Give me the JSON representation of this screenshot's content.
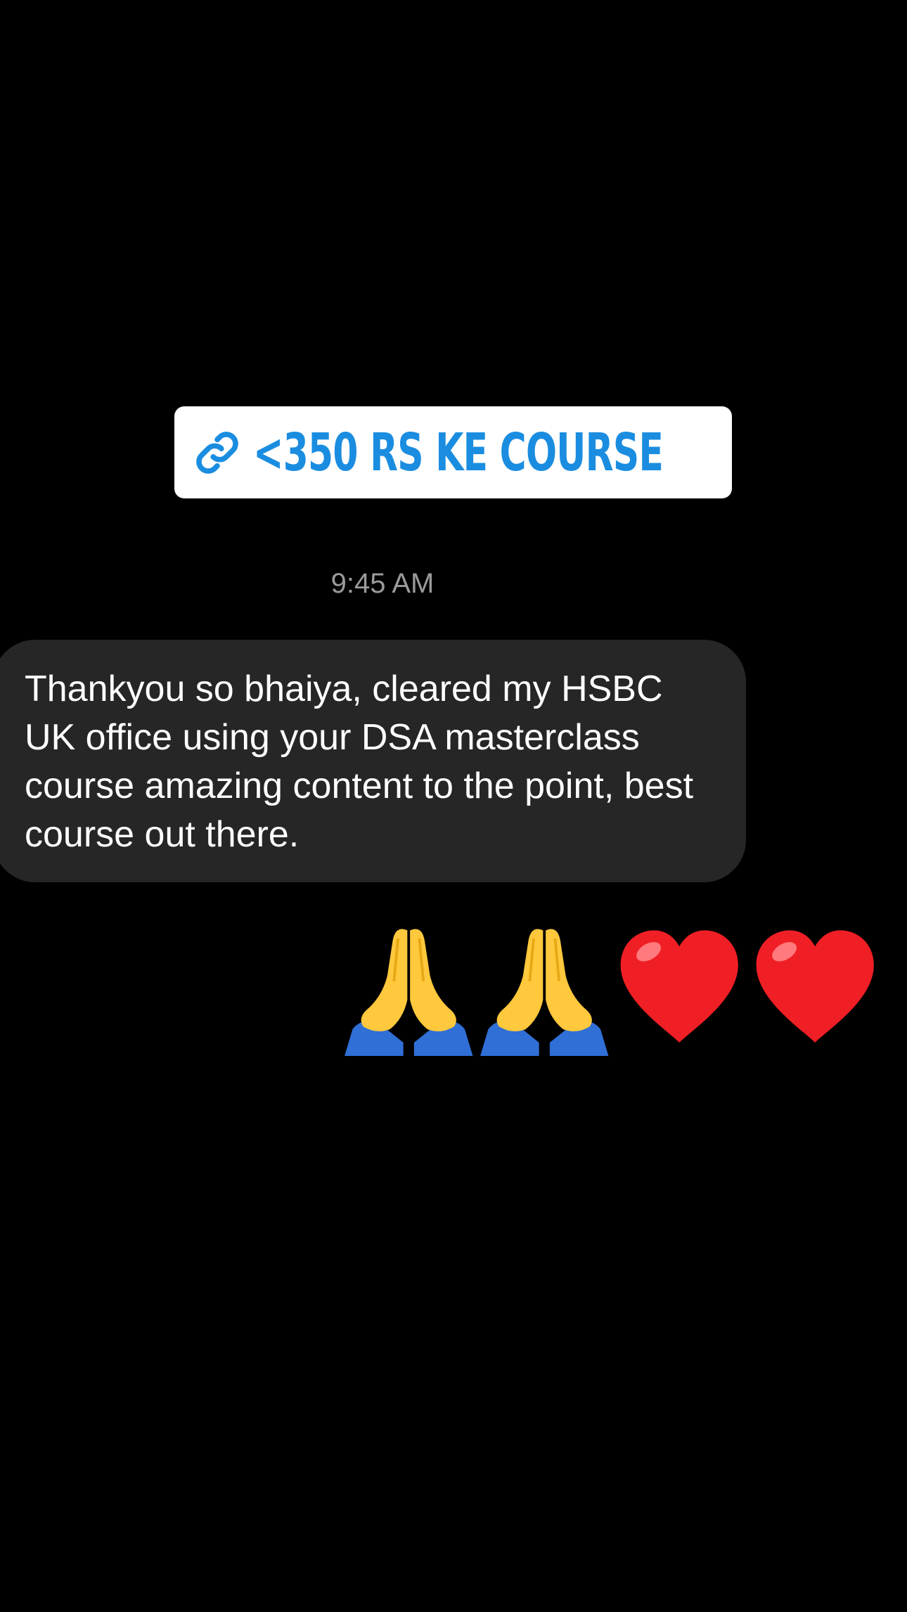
{
  "link_sticker": {
    "icon": "link-icon",
    "label": "<350 RS KE COURSE",
    "color": "#1a8de0"
  },
  "timestamp": "9:45 AM",
  "message": {
    "text": "Thankyou so bhaiya, cleared my HSBC UK office using your DSA masterclass course amazing content to the point, best course out there."
  },
  "reactions": [
    {
      "icon": "folded-hands-icon"
    },
    {
      "icon": "folded-hands-icon"
    },
    {
      "icon": "red-heart-icon"
    },
    {
      "icon": "red-heart-icon"
    }
  ]
}
